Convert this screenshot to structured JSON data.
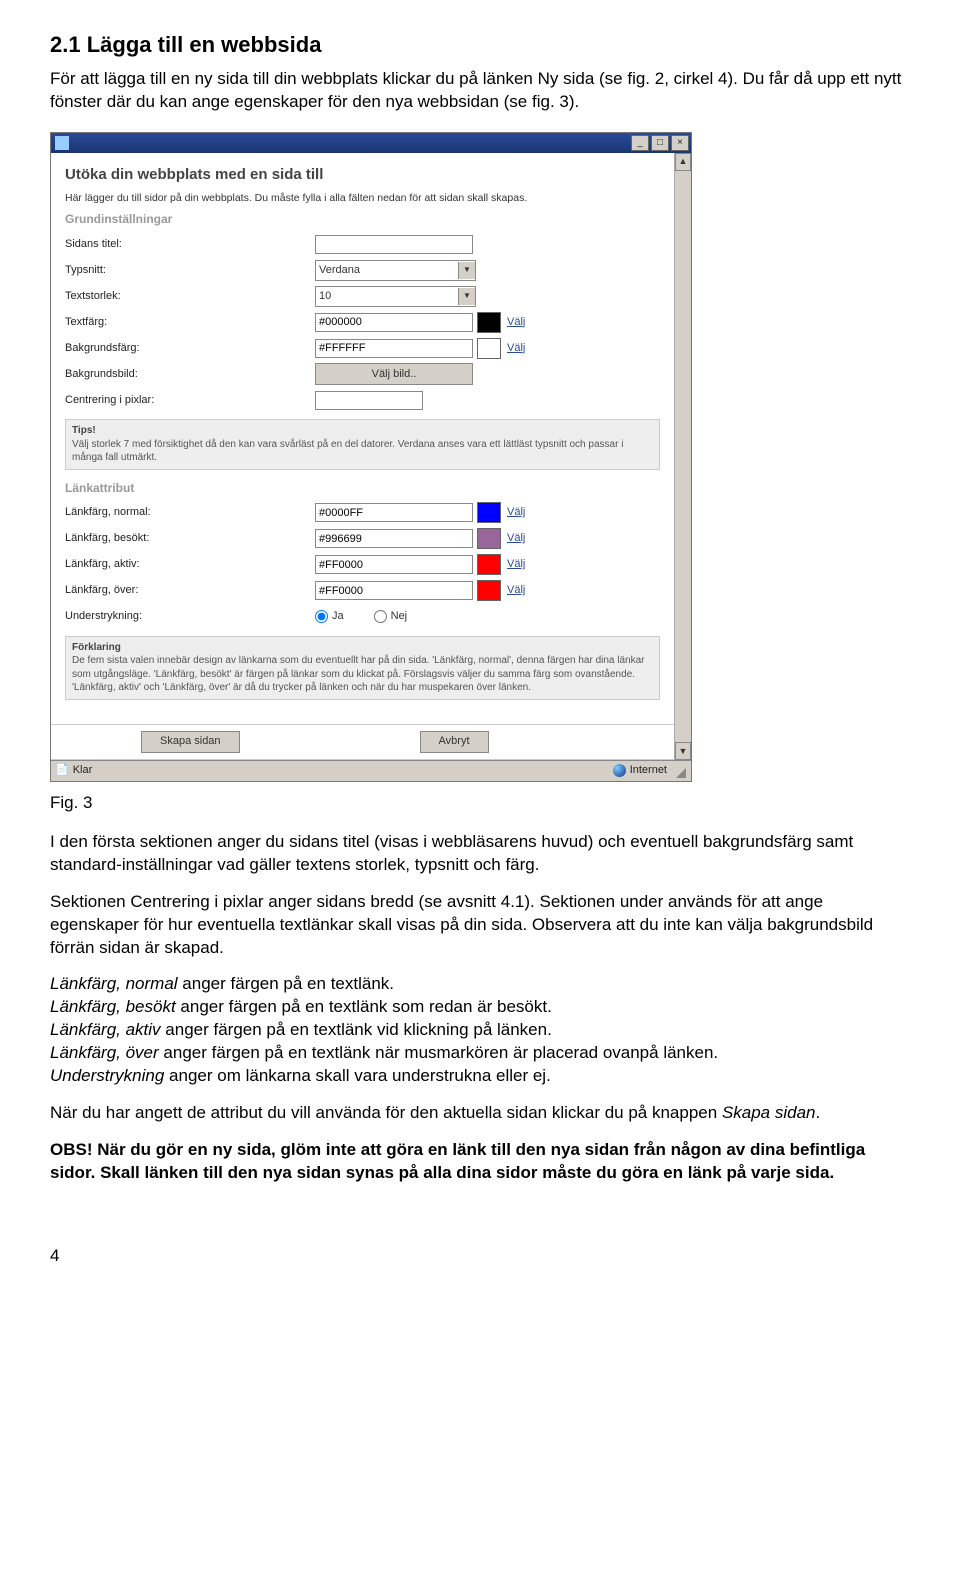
{
  "doc": {
    "section_number": "2.1",
    "section_title": "Lägga till en webbsida",
    "intro_p": "För att lägga till en ny sida till din webbplats klickar du på länken Ny sida (se fig. 2, cirkel 4). Du får då upp ett nytt fönster där du kan ange egenskaper för den nya webbsidan (se fig. 3).",
    "fig_caption": "Fig. 3",
    "p_first_section": "I den första sektionen anger du sidans titel (visas i webbläsarens huvud) och eventuell bakgrundsfärg samt standard-inställningar vad gäller textens storlek, typsnitt och färg.",
    "p_centrering": "Sektionen Centrering i pixlar anger sidans bredd (se avsnitt 4.1). Sektionen under används för att ange egenskaper för hur eventuella textlänkar skall visas på din sida. Observera att du inte kan välja bakgrundsbild förrän sidan är skapad.",
    "li_normal_prefix": "Länkfärg, normal",
    "li_normal_text": " anger färgen på en textlänk.",
    "li_besokt_prefix": "Länkfärg, besökt",
    "li_besokt_text": " anger färgen på en textlänk som redan är besökt.",
    "li_aktiv_prefix": "Länkfärg, aktiv",
    "li_aktiv_text": " anger färgen på en textlänk vid klickning på länken.",
    "li_over_prefix": "Länkfärg, över",
    "li_over_text": " anger färgen på en textlänk när musmarkören är placerad ovanpå länken.",
    "li_under_prefix": "Understrykning",
    "li_under_text": " anger om länkarna skall vara understrukna eller ej.",
    "p_after": "När du har angett de attribut du vill använda för den aktuella sidan klickar du på knappen ",
    "p_after_em": "Skapa sidan",
    "p_after_tail": ".",
    "obs_strong": "OBS! När du gör en ny sida, glöm inte att göra en länk till den nya sidan från någon av dina befintliga sidor. Skall länken till den nya sidan synas på alla dina sidor måste du göra en länk på varje sida.",
    "page_number": "4"
  },
  "win": {
    "title_heading": "Utöka din webbplats med en sida till",
    "intro": "Här lägger du till sidor på din webbplats. Du måste fylla i alla fälten nedan för att sidan skall skapas.",
    "sub_basic": "Grundinställningar",
    "labels": {
      "titel": "Sidans titel:",
      "typsnitt": "Typsnitt:",
      "textstorlek": "Textstorlek:",
      "textfarg": "Textfärg:",
      "bgfarg": "Bakgrundsfärg:",
      "bgbild": "Bakgrundsbild:",
      "centrering": "Centrering i pixlar:"
    },
    "values": {
      "typsnitt": "Verdana",
      "textstorlek": "10",
      "textfarg": "#000000",
      "bgfarg": "#FFFFFF",
      "link_normal": "#0000FF",
      "link_visited": "#996699",
      "link_active": "#FF0000",
      "link_over": "#FF0000"
    },
    "valj": "Välj",
    "valj_bild": "Välj bild..",
    "tips_head": "Tips!",
    "tips_body": "Välj storlek 7 med försiktighet då den kan vara svårläst på en del datorer. Verdana anses vara ett lättläst typsnitt och passar i många fall utmärkt.",
    "sub_link": "Länkattribut",
    "link_labels": {
      "normal": "Länkfärg, normal:",
      "visited": "Länkfärg, besökt:",
      "active": "Länkfärg, aktiv:",
      "over": "Länkfärg, över:",
      "underline": "Understrykning:"
    },
    "radio_yes": "Ja",
    "radio_no": "Nej",
    "explain_head": "Förklaring",
    "explain_body": "De fem sista valen innebär design av länkarna som du eventuellt har på din sida. 'Länkfärg, normal', denna färgen har dina länkar som utgångsläge. 'Länkfärg, besökt' är färgen på länkar som du klickat på. Förslagsvis väljer du samma färg som ovanstående. 'Länkfärg, aktiv' och 'Länkfärg, över' är då du trycker på länken och när du har muspekaren över länken.",
    "btn_create": "Skapa sidan",
    "btn_cancel": "Avbryt",
    "status_left": "Klar",
    "status_right": "Internet"
  }
}
